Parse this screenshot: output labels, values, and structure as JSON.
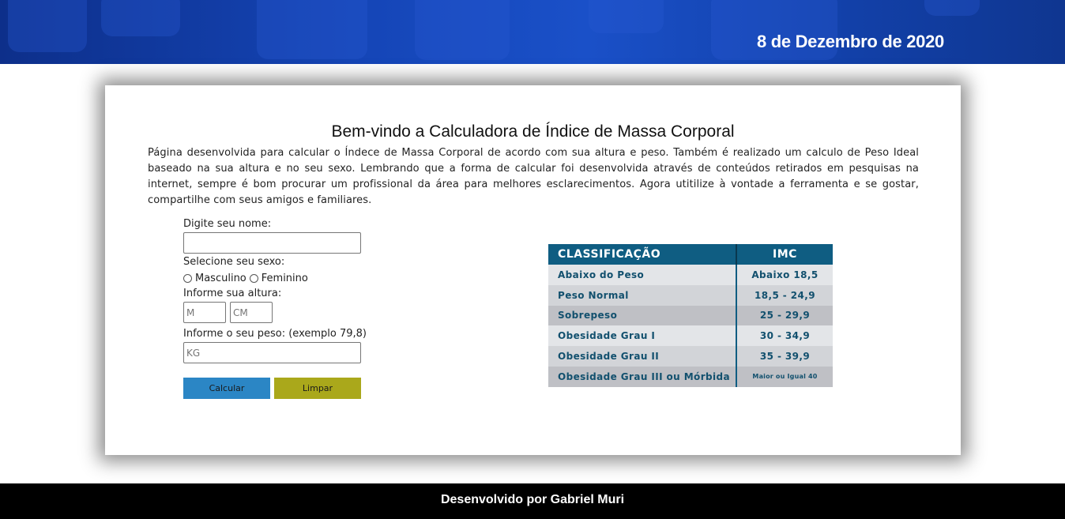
{
  "header": {
    "date": "8 de Dezembro de 2020"
  },
  "main": {
    "title": "Bem-vindo a Calculadora de Índice de Massa Corporal",
    "intro": "Página desenvolvida para calcular o Índece de Massa Corporal de acordo com sua altura e peso. Também é realizado um calculo de Peso Ideal baseado na sua altura e no seu sexo. Lembrando que a forma de calcular foi desenvolvida através de conteúdos retirados em pesquisas na internet, sempre é bom procurar um profissional da área para melhores esclarecimentos. Agora utitilize à vontade a ferramenta e se gostar, compartilhe com seus amigos e familiares."
  },
  "form": {
    "name_label": "Digite seu nome:",
    "name_value": "",
    "sex_label": "Selecione seu sexo:",
    "sex_options": [
      "Masculino",
      "Feminino"
    ],
    "height_label": "Informe sua altura:",
    "height_m_placeholder": "M",
    "height_cm_placeholder": "CM",
    "weight_label": "Informe o seu peso: (exemplo 79,8)",
    "weight_placeholder": "KG",
    "calc_button": "Calcular",
    "clear_button": "Limpar"
  },
  "bmi_table": {
    "headers": [
      "CLASSIFICAÇÃO",
      "IMC"
    ],
    "rows": [
      [
        "Abaixo do Peso",
        "Abaixo 18,5"
      ],
      [
        "Peso Normal",
        "18,5 - 24,9"
      ],
      [
        "Sobrepeso",
        "25 - 29,9"
      ],
      [
        "Obesidade Grau I",
        "30 - 34,9"
      ],
      [
        "Obesidade Grau II",
        "35 - 39,9"
      ],
      [
        "Obesidade Grau III ou Mórbida",
        "Maior ou Igual 40"
      ]
    ]
  },
  "footer": {
    "text": "Desenvolvido por Gabriel Muri"
  },
  "colors": {
    "header_blue": "#1546b8",
    "table_header": "#0f5d82",
    "calc_button": "#2b86c5",
    "clear_button": "#aaa81b",
    "footer": "#000000"
  }
}
